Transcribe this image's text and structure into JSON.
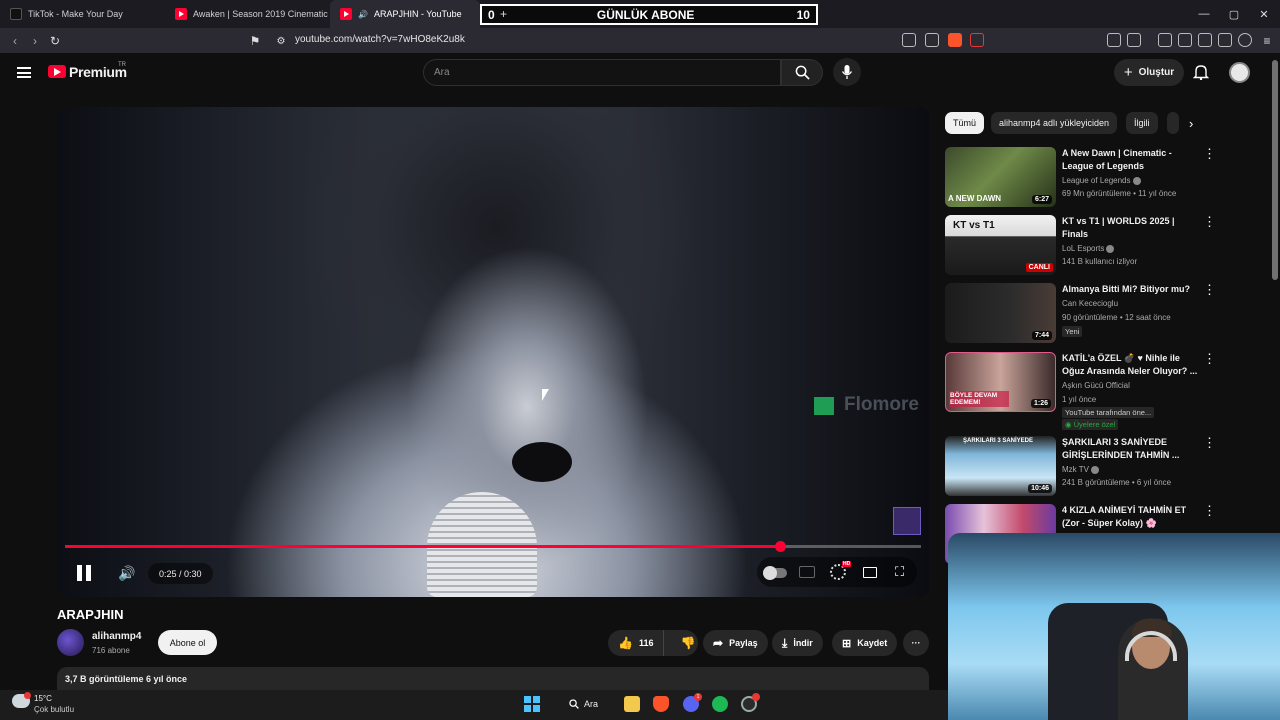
{
  "browser": {
    "tabs": [
      {
        "title": "TikTok - Make Your Day",
        "favicon": "tiktok-icon"
      },
      {
        "title": "Awaken | Season 2019 Cinematic - Le",
        "favicon": "youtube-icon"
      },
      {
        "title": "ARAPJHIN - YouTube",
        "favicon": "youtube-icon",
        "active": true
      }
    ],
    "new_tab": "+",
    "url": "youtube.com/watch?v=7wHO8eK2u8k"
  },
  "stream_overlay": {
    "left": "0",
    "title": "GÜNLÜK ABONE",
    "right": "10"
  },
  "youtube": {
    "brand": "Premium",
    "region": "TR",
    "search_placeholder": "Ara",
    "create_label": "Oluştur"
  },
  "player": {
    "time": "0:25 / 0:30",
    "progress": 0.835,
    "watermark": "Flomore",
    "hd_badge": "HD"
  },
  "video": {
    "title": "ARAPJHIN",
    "channel": "alihanmp4",
    "subscribers": "716 abone",
    "subscribe_label": "Abone ol",
    "likes": "116",
    "share_label": "Paylaş",
    "download_label": "İndir",
    "save_label": "Kaydet",
    "views_line": "3,7 B görüntüleme  6 yıl önce"
  },
  "rail": {
    "chips": [
      "Tümü",
      "alihanmp4 adlı yükleyiciden",
      "İlgili"
    ],
    "items": [
      {
        "title": "A New Dawn | Cinematic - League of Legends",
        "channel": "League of Legends",
        "meta": "69 Mn görüntüleme • 11 yıl önce",
        "duration": "6:27",
        "thumb_caption": "A NEW DAWN"
      },
      {
        "title": "KT vs T1 | WORLDS 2025 | Finals",
        "channel": "LoL Esports",
        "meta": "141 B kullanıcı izliyor",
        "live": "CANLI",
        "thumb_caption": "KT vs T1"
      },
      {
        "title": "Almanya Bitti Mi? Bitiyor mu?",
        "channel": "Can Kececioglu",
        "meta": "90 görüntüleme • 12 saat önce",
        "badge": "Yeni",
        "duration": "7:44"
      },
      {
        "title": "KATİL'a ÖZEL 💣 ♥ Nihle ile Oğuz Arasında Neler Oluyor? ...",
        "channel": "Aşkın Gücü Official",
        "meta": "1 yıl önce",
        "badge": "YouTube tarafından öne...",
        "badge2": "Üyelere özel",
        "duration": "1:26",
        "thumb_caption": "BÖYLE DEVAM EDEMEM!"
      },
      {
        "title": "ŞARKILARI 3 SANİYEDE GİRİŞLERİNDEN TAHMİN ...",
        "channel": "Mzk TV",
        "meta": "241 B görüntüleme • 6 yıl önce",
        "duration": "10:46",
        "thumb_caption": "ŞARKILARI 3 SANİYEDE"
      },
      {
        "title": "4 KIZLA ANİMEYİ TAHMİN ET (Zor - Süper Kolay) 🌸",
        "channel": "",
        "meta": ""
      }
    ]
  },
  "taskbar": {
    "temp": "15°C",
    "weather": "Çok bulutlu",
    "search_label": "Ara",
    "notif": "1"
  },
  "colors": {
    "accent": "#ff0033",
    "bg": "#0f0f0f",
    "chip_bg": "#272727"
  }
}
